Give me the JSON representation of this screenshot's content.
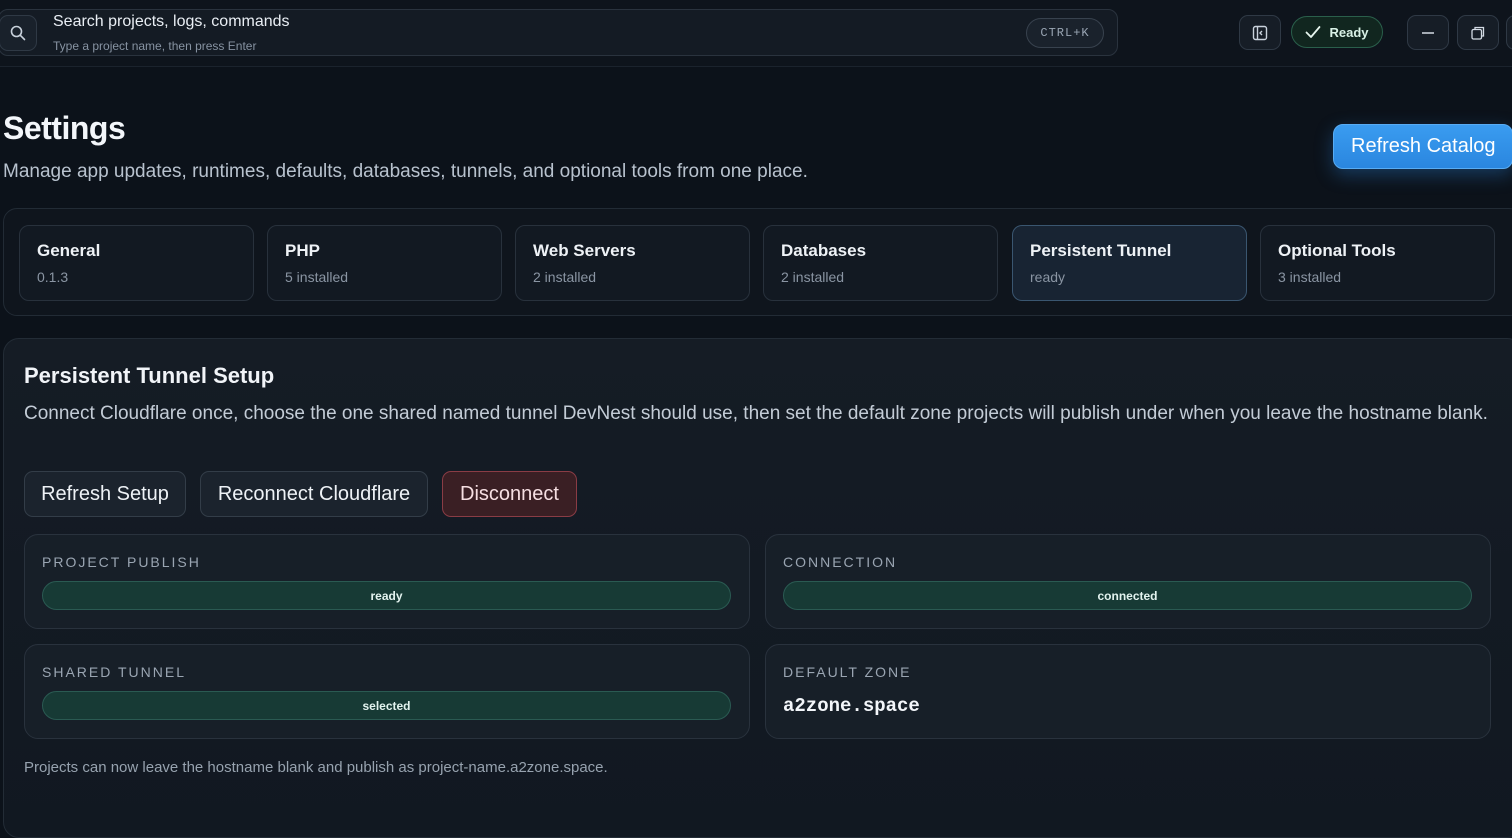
{
  "topbar": {
    "search_title": "Search projects, logs, commands",
    "search_sub": "Type a project name, then press Enter",
    "shortcut": "CTRL+K",
    "status": "Ready"
  },
  "header": {
    "title": "Settings",
    "subtitle": "Manage app updates, runtimes, defaults, databases, tunnels, and optional tools from one place.",
    "refresh_label": "Refresh Catalog"
  },
  "tabs": [
    {
      "title": "General",
      "sub": "0.1.3"
    },
    {
      "title": "PHP",
      "sub": "5 installed"
    },
    {
      "title": "Web Servers",
      "sub": "2 installed"
    },
    {
      "title": "Databases",
      "sub": "2 installed"
    },
    {
      "title": "Persistent Tunnel",
      "sub": "ready"
    },
    {
      "title": "Optional Tools",
      "sub": "3 installed"
    }
  ],
  "panel": {
    "title": "Persistent Tunnel Setup",
    "description": "Connect Cloudflare once, choose the one shared named tunnel DevNest should use, then set the default zone projects will publish under when you leave the hostname blank.",
    "actions": {
      "refresh": "Refresh Setup",
      "reconnect": "Reconnect Cloudflare",
      "disconnect": "Disconnect"
    },
    "cards": {
      "project_publish": {
        "label": "PROJECT PUBLISH",
        "value": "ready"
      },
      "connection": {
        "label": "CONNECTION",
        "value": "connected"
      },
      "shared_tunnel": {
        "label": "SHARED TUNNEL",
        "value": "selected"
      },
      "default_zone": {
        "label": "DEFAULT ZONE",
        "value": "a2zone.space"
      }
    },
    "footnote": "Projects can now leave the hostname blank and publish as project-name.a2zone.space."
  },
  "colors": {
    "accent": "#2a86df",
    "success": "#173a35",
    "danger": "#8a3c45"
  }
}
